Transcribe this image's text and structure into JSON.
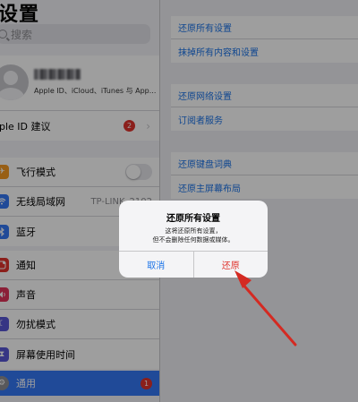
{
  "sidebar": {
    "title": "设置",
    "search_placeholder": "搜索",
    "profile_subtitle": "Apple ID、iCloud、iTunes 与 App...",
    "apple_id_suggest": {
      "label": "pple ID 建议",
      "badge": "2"
    },
    "network": [
      {
        "label": "飞行模式",
        "icon": "airplane-icon",
        "color": "#f59a23",
        "control": "toggle"
      },
      {
        "label": "无线局域网",
        "icon": "wifi-icon",
        "color": "#3478f6",
        "value": "TP-LINK_2102"
      },
      {
        "label": "蓝牙",
        "icon": "bluetooth-icon",
        "color": "#3478f6"
      }
    ],
    "system": [
      {
        "label": "通知",
        "icon": "notifications-icon",
        "color": "#e0322c"
      },
      {
        "label": "声音",
        "icon": "sound-icon",
        "color": "#e0325a"
      },
      {
        "label": "勿扰模式",
        "icon": "moon-icon",
        "color": "#5856d6"
      },
      {
        "label": "屏幕使用时间",
        "icon": "hourglass-icon",
        "color": "#5856d6"
      }
    ],
    "general": {
      "label": "通用",
      "badge": "1"
    }
  },
  "right": {
    "group1": [
      "还原所有设置",
      "抹掉所有内容和设置"
    ],
    "group2": [
      "还原网络设置",
      "订阅者服务"
    ],
    "group3": [
      "还原键盘词典",
      "还原主屏幕布局"
    ]
  },
  "alert": {
    "title": "还原所有设置",
    "message_line1": "这将还原所有设置，",
    "message_line2": "但不会删除任何数据或媒体。",
    "cancel": "取消",
    "restore": "还原"
  },
  "colors": {
    "accent": "#1a73e8",
    "destructive": "#e0322c",
    "annotation_arrow": "#d42a22"
  }
}
